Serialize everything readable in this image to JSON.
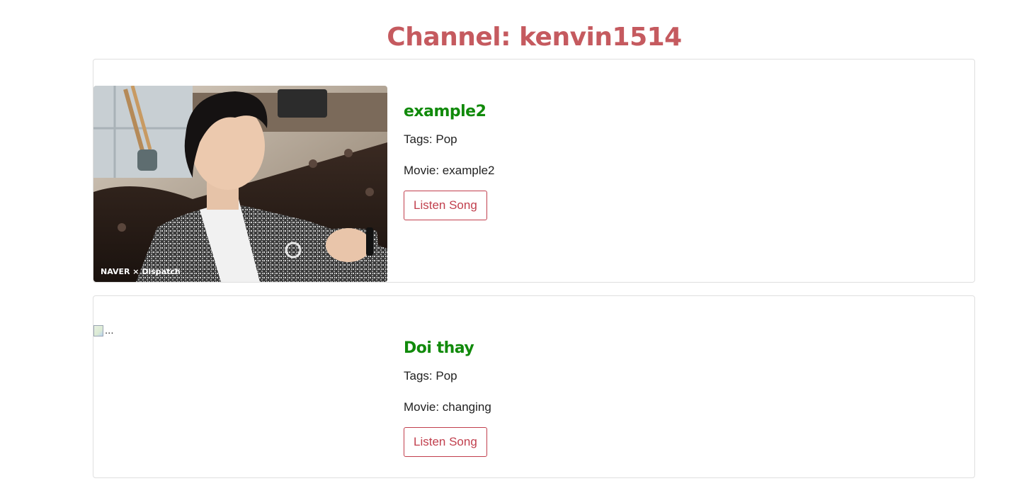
{
  "page": {
    "title": "Channel: kenvin1514"
  },
  "songs": [
    {
      "name": "example2",
      "tags_label": "Tags: Pop",
      "movie_label": "Movie: example2",
      "button_label": "Listen Song",
      "image_caption": "NAVER × Dispatch",
      "image_alt": ""
    },
    {
      "name": "Doi thay",
      "tags_label": "Tags: Pop",
      "movie_label": "Movie: changing",
      "button_label": "Listen Song",
      "image_alt": "..."
    }
  ],
  "colors": {
    "title": "#c55a5f",
    "song_name": "#118a0b",
    "button": "#c13f4d"
  }
}
